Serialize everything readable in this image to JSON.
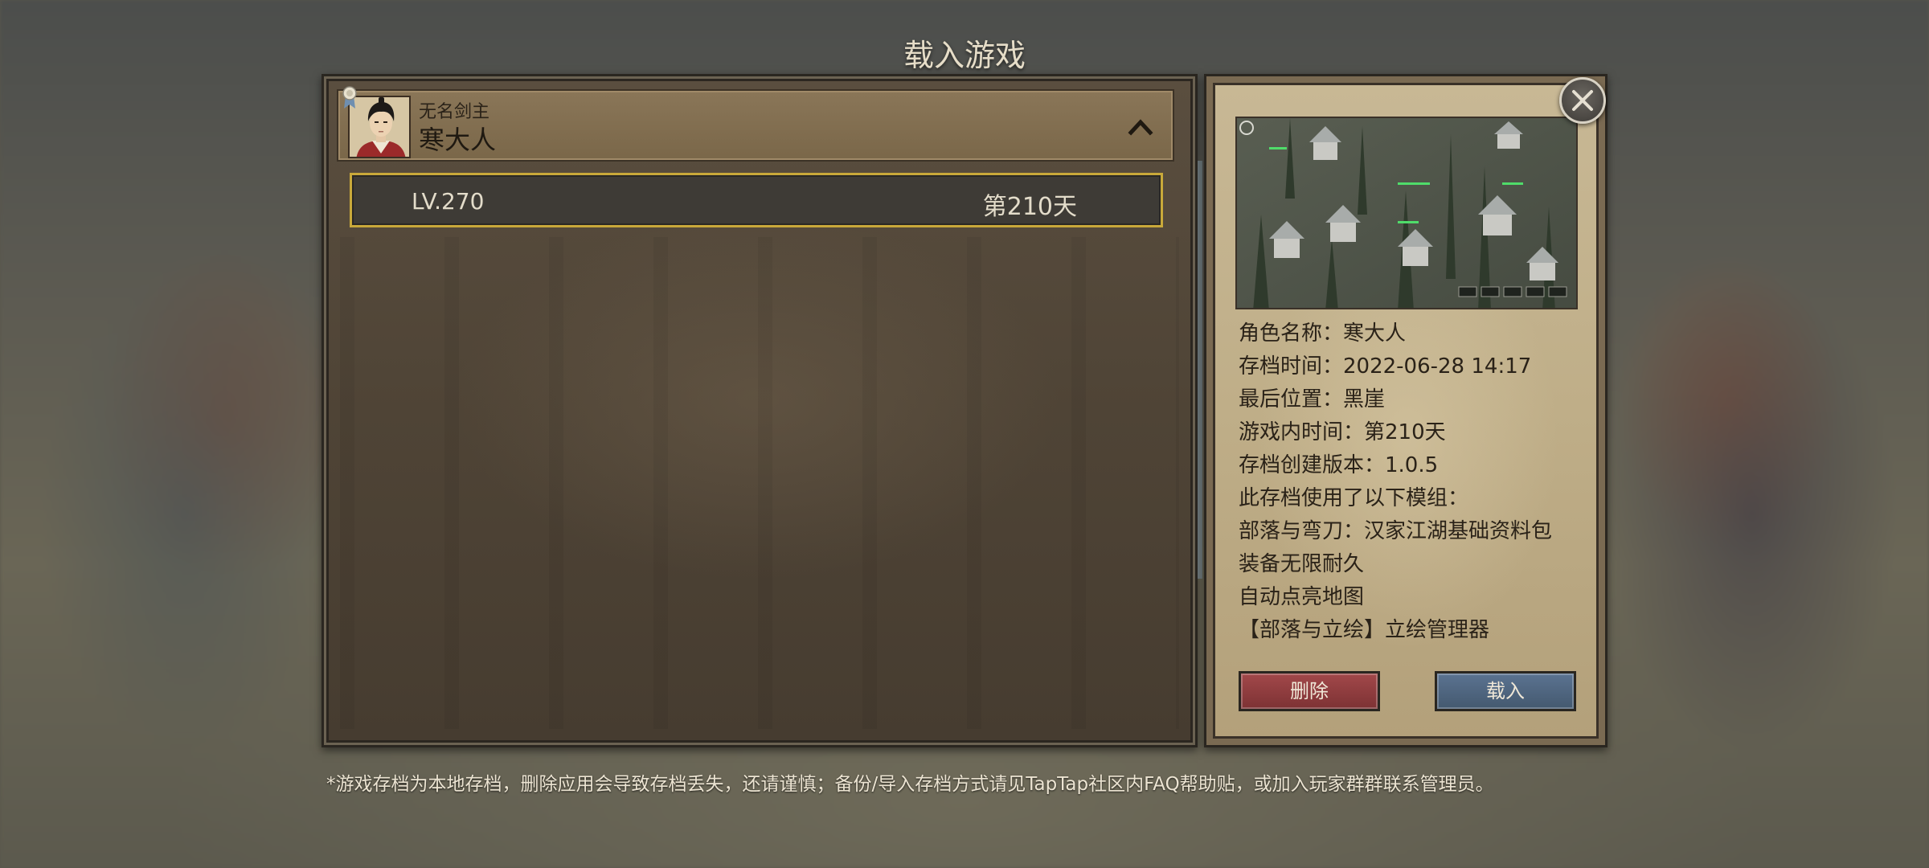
{
  "screen": {
    "title": "载入游戏"
  },
  "save_group": {
    "subtitle": "无名剑主",
    "character_name": "寒大人",
    "avatar_icon": "character-portrait",
    "medal_icon": "medal-icon",
    "collapse_icon": "chevron-up-icon"
  },
  "save_slots": [
    {
      "level": "LV.270",
      "day": "第210天",
      "selected": true
    }
  ],
  "details": {
    "lines": [
      "角色名称：寒大人",
      "存档时间：2022-06-28 14:17",
      "最后位置：黑崖",
      "游戏内时间：第210天",
      "存档创建版本：1.0.5",
      "此存档使用了以下模组：",
      "部落与弯刀：汉家江湖基础资料包",
      "装备无限耐久",
      "自动点亮地图",
      "【部落与立绘】立绘管理器"
    ]
  },
  "buttons": {
    "delete": "删除",
    "load": "载入",
    "close_icon": "close-icon"
  },
  "notice": "*游戏存档为本地存档，删除应用会导致存档丢失，还请谨慎；备份/导入存档方式请见TapTap社区内FAQ帮助贴，或加入玩家群群联系管理员。",
  "colors": {
    "selection_border": "#c9a93a",
    "delete_button": "#8f3d3f",
    "load_button": "#506780",
    "parchment": "#c2b18b"
  }
}
